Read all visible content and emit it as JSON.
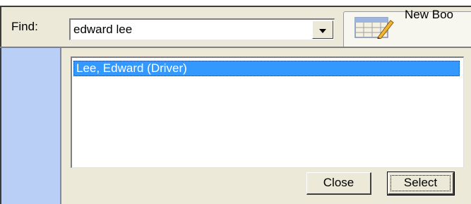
{
  "header": {
    "find_label": "Find:",
    "search_value": "edward lee",
    "new_booking_label": "New Boo"
  },
  "results": {
    "items": [
      {
        "label": "Lee, Edward (Driver)",
        "selected": true
      }
    ]
  },
  "actions": {
    "close_label": "Close",
    "select_label": "Select"
  },
  "colors": {
    "selection": "#3399ff",
    "left_pane": "#b9cff5",
    "dialog_bg": "#ece9d8"
  },
  "icons": {
    "new_booking": "calendar-pencil-icon",
    "dropdown": "chevron-down-icon"
  }
}
